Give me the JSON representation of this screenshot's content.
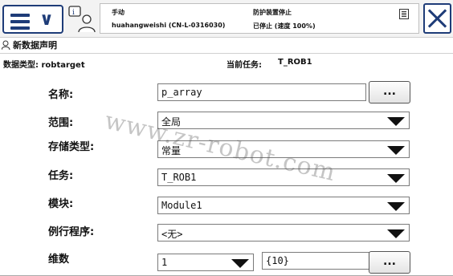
{
  "header": {
    "mode": "手动",
    "controller": "huahangweishi (CN-L-0316030)",
    "guard_status": "防护装置停止",
    "run_status": "已停止 (速度 100%)"
  },
  "window": {
    "title": "新数据声明"
  },
  "info": {
    "datatype_label": "数据类型: robtarget",
    "task_label": "当前任务:",
    "task_value": "T_ROB1"
  },
  "form": {
    "name": {
      "label": "名称:",
      "value": "p_array",
      "button": "..."
    },
    "scope": {
      "label": "范围:",
      "value": "全局"
    },
    "storage": {
      "label": "存储类型:",
      "value": "常量"
    },
    "task": {
      "label": "任务:",
      "value": "T_ROB1"
    },
    "module": {
      "label": "模块:",
      "value": "Module1"
    },
    "routine": {
      "label": "例行程序:",
      "value": "<无>"
    },
    "dims": {
      "label": "维数",
      "value": "1",
      "size": "{10}",
      "button": "..."
    }
  },
  "watermark": "www.zr-robot.com"
}
